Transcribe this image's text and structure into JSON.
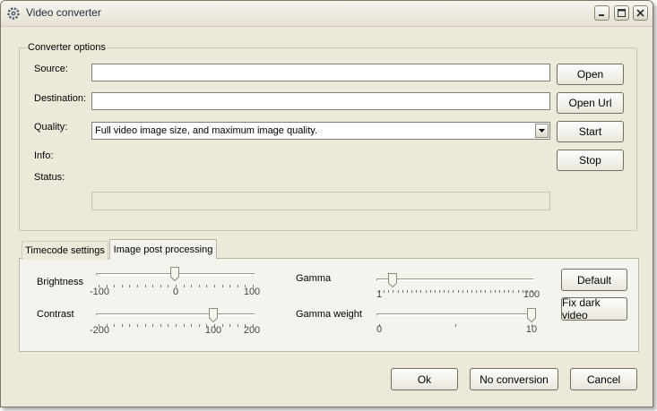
{
  "window": {
    "title": "Video converter"
  },
  "converter": {
    "group_label": "Converter options",
    "source_label": "Source:",
    "source_value": "",
    "destination_label": "Destination:",
    "destination_value": "",
    "quality_label": "Quality:",
    "quality_value": "Full video image size, and maximum image quality.",
    "info_label": "Info:",
    "status_label": "Status:",
    "progress": 0
  },
  "side_buttons": {
    "open": "Open",
    "open_url": "Open Url",
    "start": "Start",
    "stop": "Stop"
  },
  "tabs": [
    {
      "label": "Timecode settings"
    },
    {
      "label": "Image post processing",
      "active": true
    }
  ],
  "post": {
    "brightness": {
      "label": "Brightness",
      "min": "-100",
      "mid": "0",
      "max": "100",
      "value": 0
    },
    "contrast": {
      "label": "Contrast",
      "min": "-200",
      "mid": "100",
      "max": "200",
      "value": 100
    },
    "gamma": {
      "label": "Gamma",
      "min": "1",
      "max": "100",
      "value": 10
    },
    "gamma_weight": {
      "label": "Gamma weight",
      "min": "0",
      "max": "10",
      "value": 10
    },
    "default_label": "Default",
    "fix_dark_label": "Fix dark video"
  },
  "footer": {
    "ok": "Ok",
    "no_conversion": "No conversion",
    "cancel": "Cancel"
  }
}
